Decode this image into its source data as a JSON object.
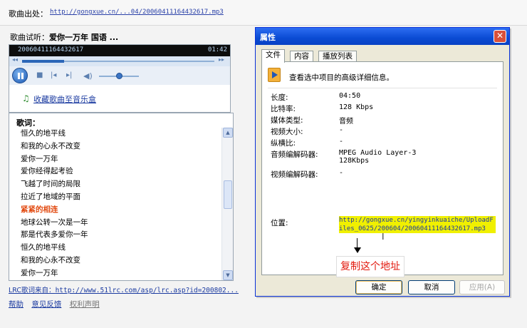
{
  "source": {
    "label": "歌曲出处：",
    "url": "http://gongxue.cn/...04/20060411164432617.mp3"
  },
  "preview": {
    "label": "歌曲试听：",
    "song": "爱你一万年 国语 ..."
  },
  "player": {
    "filename": "20060411164432617",
    "time": "01:42",
    "progress": 0.22,
    "volume": 0.5,
    "icons": [
      "pause-icon",
      "stop-icon",
      "prev-icon",
      "next-icon",
      "volume-icon"
    ],
    "accent": "#2b66b8"
  },
  "favorite": {
    "label": "收藏歌曲至音乐盒",
    "icon": "favorite-icon"
  },
  "lyrics": {
    "heading": "歌词：",
    "lines": [
      "恒久的地平线",
      "和我的心永不改变",
      "爱你一万年",
      "爱你经得起考验",
      "飞越了时间的局限",
      "拉近了地域的平面",
      "紧紧的相连",
      "地球公转一次是一年",
      "那是代表多爱你一年",
      "恒久的地平线",
      "和我的心永不改变",
      "爱你一万年"
    ],
    "current_index": 6,
    "current_color": "#e24b12"
  },
  "lrc_source": {
    "label": "LRC歌词来自：",
    "url": "http://www.51lrc.com/asp/lrc.asp?id=200802..."
  },
  "footer": {
    "help": "帮助",
    "feedback": "意见反馈",
    "rights": "权利声明"
  },
  "dialog": {
    "title": "属性",
    "close_icon": "close-icon",
    "tabs": [
      {
        "label": "文件",
        "active": true
      },
      {
        "label": "内容",
        "active": false
      },
      {
        "label": "播放列表",
        "active": false
      }
    ],
    "description": "查看选中项目的高级详细信息。",
    "properties": [
      {
        "label": "长度:",
        "value": "04:50"
      },
      {
        "label": "比特率:",
        "value": "128 Kbps"
      },
      {
        "label": "媒体类型:",
        "value": "音频"
      },
      {
        "label": "视频大小:",
        "value": "-"
      },
      {
        "label": "纵横比:",
        "value": "-"
      },
      {
        "label": "音频编解码器:",
        "value": "MPEG Audio Layer-3\n128Kbps"
      },
      {
        "label": "视频编解码器:",
        "value": "-"
      }
    ],
    "location_label": "位置:",
    "location_value": "http://gongxue.cn/yingyinkuaiche/UploadFiles_0625/200604/20060411164432617.mp3",
    "annotation": "复制这个地址",
    "annotation_color": "#e2190e",
    "buttons": {
      "ok": "确定",
      "cancel": "取消",
      "apply": "应用(A)"
    },
    "title_color": "#0a4bd3"
  }
}
